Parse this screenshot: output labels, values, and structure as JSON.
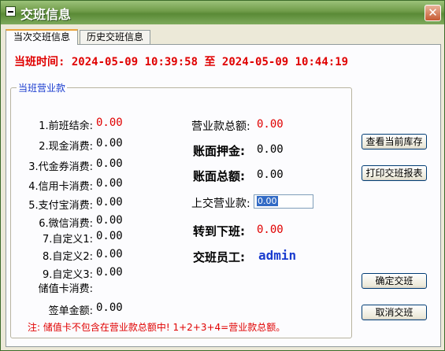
{
  "window": {
    "title": "交班信息",
    "close_glyph": "✕"
  },
  "tabs": [
    {
      "label": "当次交班信息",
      "active": true
    },
    {
      "label": "历史交班信息",
      "active": false
    }
  ],
  "shift_time": {
    "label": "当班时间:",
    "start": "2024-05-09 10:39:58",
    "to": "至",
    "end": "2024-05-09 10:44:19"
  },
  "group_title": "当班营业款",
  "items": [
    {
      "label": "1.前班结余:",
      "value": "0.00",
      "value_color": "red"
    },
    {
      "label": "2.现金消费:",
      "value": "0.00"
    },
    {
      "label": "3.代金券消费:",
      "value": "0.00"
    },
    {
      "label": "4.信用卡消费:",
      "value": "0.00"
    },
    {
      "label": "5.支付宝消费:",
      "value": "0.00"
    },
    {
      "label": "6.微信消费:",
      "value": "0.00"
    },
    {
      "label": "7.自定义1:",
      "value": "0.00"
    },
    {
      "label": "8.自定义2:",
      "value": "0.00"
    },
    {
      "label": "9.自定义3:",
      "value": "0.00"
    },
    {
      "label": "储值卡消费:",
      "value": ""
    },
    {
      "label": "签单金额:",
      "value": "0.00"
    }
  ],
  "totals": {
    "business_total_label": "营业款总额:",
    "business_total_value": "0.00",
    "deposit_label": "账面押金:",
    "deposit_value": "0.00",
    "book_total_label": "账面总额:",
    "book_total_value": "0.00",
    "handover_label": "上交营业款:",
    "handover_value": "0.00",
    "next_shift_label": "转到下班:",
    "next_shift_value": "0.00",
    "staff_label": "交班员工:",
    "staff_value": "admin"
  },
  "note": "注: 储值卡不包含在营业款总额中! 1+2+3+4=营业款总额。",
  "buttons": {
    "view_stock": "查看当前库存",
    "print_report": "打印交班报表",
    "confirm": "确定交班",
    "cancel": "取消交班"
  },
  "colors": {
    "accent_red": "#e00000",
    "accent_blue": "#1a3ccf",
    "title_green": "#6f9b48"
  }
}
